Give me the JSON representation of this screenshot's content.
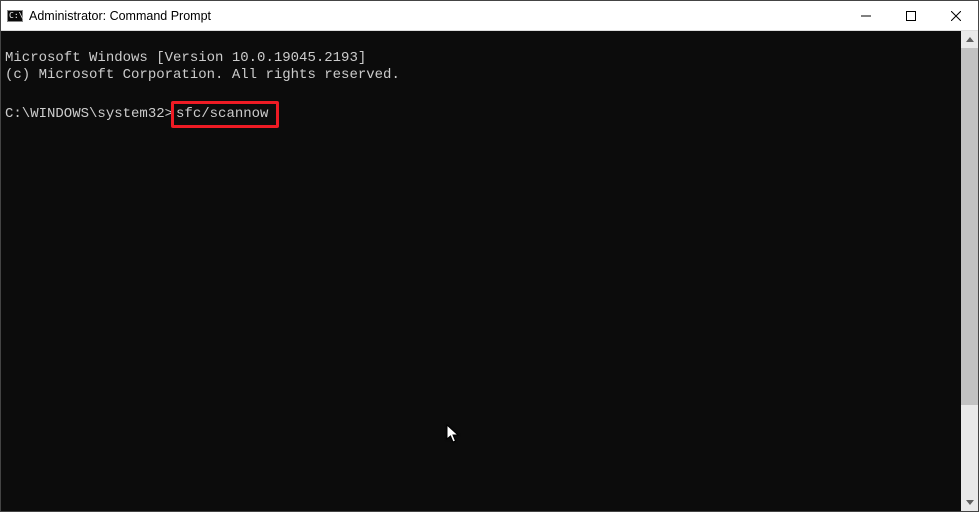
{
  "titlebar": {
    "title": "Administrator: Command Prompt"
  },
  "console": {
    "line1": "Microsoft Windows [Version 10.0.19045.2193]",
    "line2": "(c) Microsoft Corporation. All rights reserved.",
    "blank": "",
    "prompt": "C:\\WINDOWS\\system32>",
    "command": "sfc/scannow"
  }
}
